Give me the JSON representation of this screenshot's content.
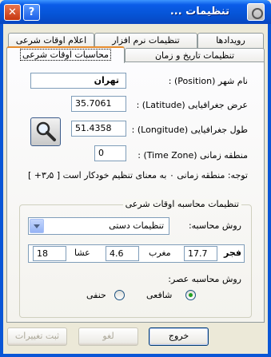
{
  "window": {
    "title": "تنظیمات ...",
    "close_glyph": "✕",
    "help_glyph": "?"
  },
  "tabs": {
    "row_back": [
      "رویدادها",
      "تنظیمات نرم افزار",
      "اعلام اوقات شرعی"
    ],
    "row_front": [
      "تنظیمات تاریخ و زمان",
      "محاسبات اوقات شرعی"
    ],
    "active": "محاسبات اوقات شرعی"
  },
  "location": {
    "city_label": "نام شهر (Position) :",
    "city_value": "تهران",
    "lat_label": "عرض جغرافیایی (Latitude) :",
    "lat_value": "35.7061",
    "lon_label": "طول جغرافیایی (Longitude) :",
    "lon_value": "51.4358",
    "tz_label": "منطقه زمانی (Time Zone) :",
    "tz_value": "0",
    "note": "توجه: منطقه زمانی ۰ به معنای تنظیم خودکار است [ ۳٫۵+ ]"
  },
  "calc": {
    "group_title": "تنظیمات محاسبه اوقات شرعی",
    "method_label": "روش محاسبه:",
    "method_value": "تنظیمات دستی",
    "fajr_label": "فجر",
    "fajr_value": "17.7",
    "maghrib_label": "مغرب",
    "maghrib_value": "4.6",
    "isha_label": "عشا",
    "isha_value": "18",
    "asr_label": "روش محاسبه عصر:",
    "asr_options": [
      "شافعی",
      "حنفی"
    ],
    "asr_selected": "شافعی"
  },
  "footer": {
    "exit": "خروج",
    "cancel": "لغو",
    "apply": "ثبت تغییرات"
  },
  "icons": {
    "title": "gear-icon",
    "lookup": "magnifier-icon",
    "dropdown": "chevron-down-icon"
  }
}
